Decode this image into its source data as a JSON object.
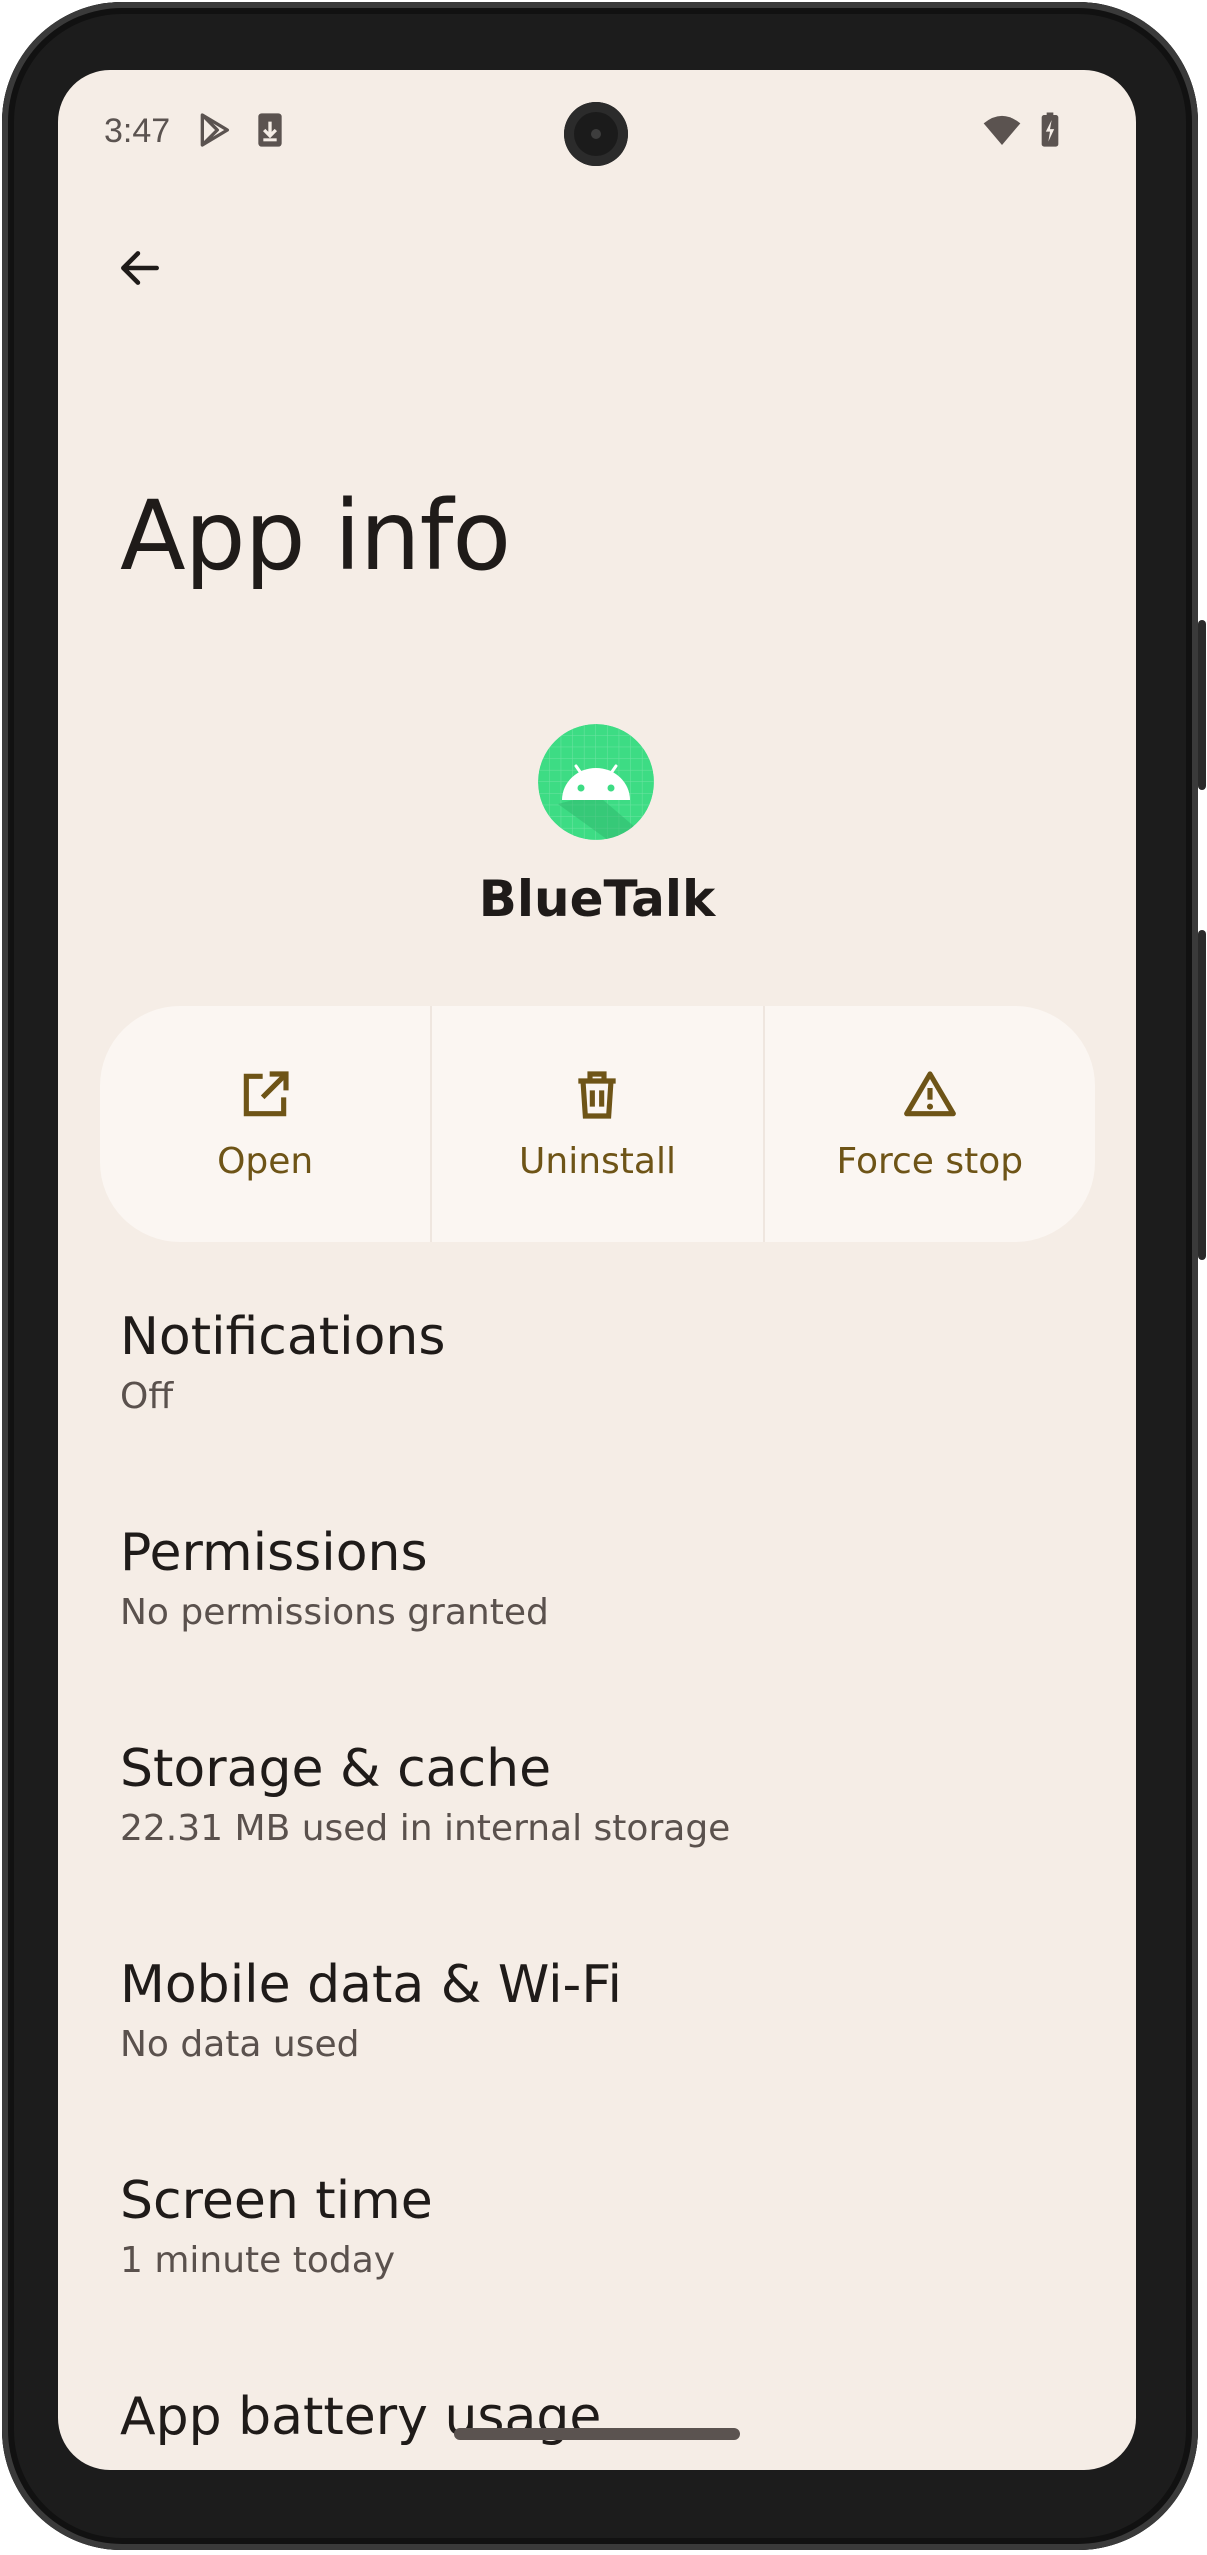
{
  "status_bar": {
    "time": "3:47",
    "left_icons": [
      "play-store-icon",
      "download-icon"
    ],
    "right_icons": [
      "wifi-icon",
      "battery-charging-icon"
    ]
  },
  "header": {
    "back_icon": "arrow-back-icon",
    "title": "App info"
  },
  "app": {
    "name": "BlueTalk",
    "icon": "android-app-icon",
    "icon_color": "#3ddc84"
  },
  "actions": [
    {
      "label": "Open",
      "icon": "open-external-icon"
    },
    {
      "label": "Uninstall",
      "icon": "trash-icon"
    },
    {
      "label": "Force stop",
      "icon": "warning-icon"
    }
  ],
  "settings": [
    {
      "title": "Notifications",
      "subtitle": "Off"
    },
    {
      "title": "Permissions",
      "subtitle": "No permissions granted"
    },
    {
      "title": "Storage & cache",
      "subtitle": "22.31 MB used in internal storage"
    },
    {
      "title": "Mobile data & Wi‑Fi",
      "subtitle": "No data used"
    },
    {
      "title": "Screen time",
      "subtitle": "1 minute today"
    },
    {
      "title": "App battery usage",
      "subtitle": ""
    }
  ],
  "colors": {
    "background": "#f5ede6",
    "accent": "#6e5417",
    "text_primary": "#1f1b19",
    "text_secondary": "#5a514d"
  }
}
